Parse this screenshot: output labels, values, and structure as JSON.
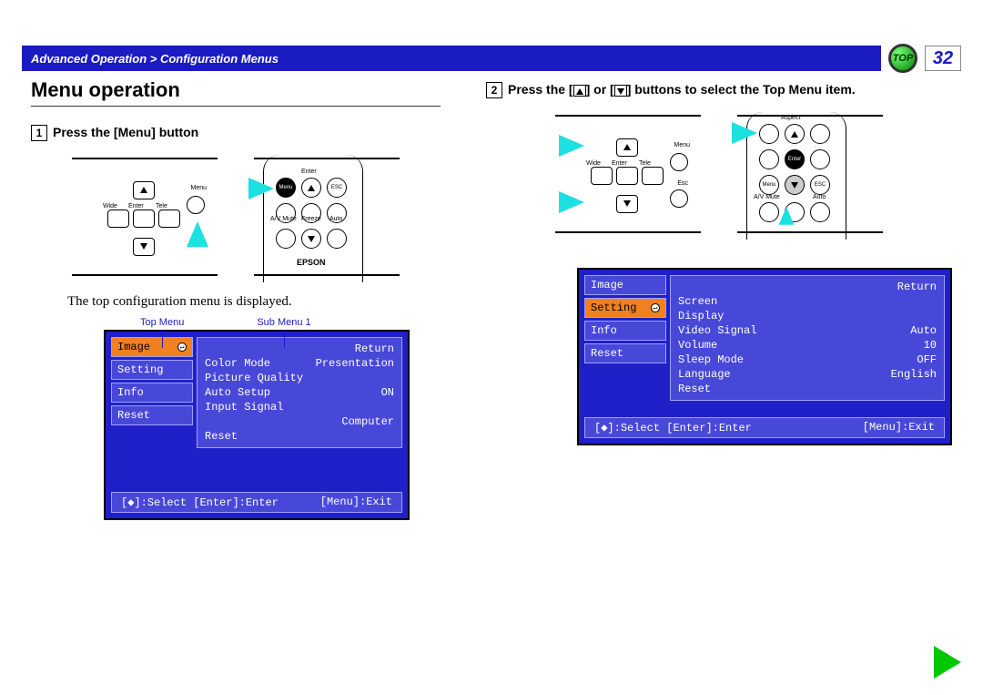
{
  "header": {
    "breadcrumb": "Advanced Operation > Configuration Menus",
    "top_label": "TOP",
    "page": "32"
  },
  "left": {
    "title": "Menu operation",
    "step1_num": "1",
    "step1_text": "Press the [Menu] button",
    "labels": {
      "menu": "Menu",
      "wide": "Wide",
      "enter": "Enter",
      "tele": "Tele",
      "esc": "ESC",
      "av_mute": "A/V Mute",
      "freeze": "Freeze",
      "auto": "Auto",
      "brand": "EPSON"
    },
    "body": "The top configuration menu is displayed.",
    "osd_labels": {
      "top": "Top Menu",
      "sub": "Sub Menu 1"
    },
    "osd": {
      "top": [
        "Image",
        "Setting",
        "Info",
        "Reset"
      ],
      "selected_index": 0,
      "sub": [
        {
          "l": "",
          "r": "Return"
        },
        {
          "l": "Color Mode",
          "r": "Presentation"
        },
        {
          "l": "Picture Quality",
          "r": ""
        },
        {
          "l": "Auto Setup",
          "r": "ON"
        },
        {
          "l": "Input Signal",
          "r": ""
        },
        {
          "l": "",
          "r": "Computer"
        },
        {
          "l": "Reset",
          "r": ""
        }
      ],
      "footer_l": "[◆]:Select [Enter]:Enter",
      "footer_r": "[Menu]:Exit"
    }
  },
  "right": {
    "step2_num": "2",
    "step2_a": "Press the [",
    "step2_b": "] or [",
    "step2_c": "] buttons to select the Top Menu item.",
    "labels": {
      "menu": "Menu",
      "wide": "Wide",
      "enter": "Enter",
      "tele": "Tele",
      "esc": "Esc",
      "aspect": "Aspect",
      "esc_cap": "ESC",
      "av_mute": "A/V Mute",
      "auto": "Auto"
    },
    "osd": {
      "top": [
        "Image",
        "Setting",
        "Info",
        "Reset"
      ],
      "selected_index": 1,
      "sub": [
        {
          "l": "",
          "r": "Return"
        },
        {
          "l": "Screen",
          "r": ""
        },
        {
          "l": "Display",
          "r": ""
        },
        {
          "l": "Video Signal",
          "r": "Auto"
        },
        {
          "l": "Volume",
          "r": "10"
        },
        {
          "l": "Sleep Mode",
          "r": "OFF"
        },
        {
          "l": "Language",
          "r": "English"
        },
        {
          "l": "Reset",
          "r": ""
        }
      ],
      "footer_l": "[◆]:Select [Enter]:Enter",
      "footer_r": "[Menu]:Exit"
    }
  }
}
